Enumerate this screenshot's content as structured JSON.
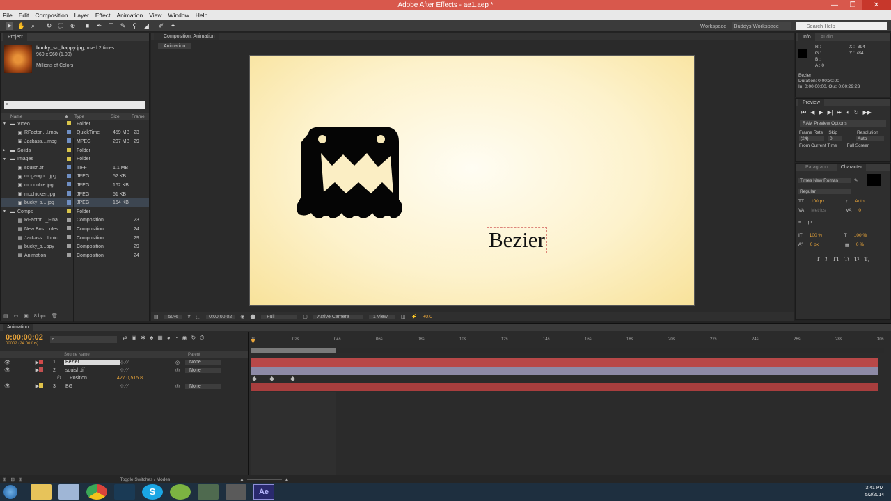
{
  "window": {
    "title": "Adobe After Effects - ae1.aep *"
  },
  "menu": [
    "File",
    "Edit",
    "Composition",
    "Layer",
    "Effect",
    "Animation",
    "View",
    "Window",
    "Help"
  ],
  "toolbar": {
    "workspace_label": "Workspace:",
    "workspace_value": "Buddys Workspace",
    "search_placeholder": "Search Help"
  },
  "project": {
    "tab": "Project",
    "selected_name": "bucky_so_happy.jpg",
    "used": ", used 2 times",
    "dims": "960 x 960 (1.00)",
    "colors": "Millions of Colors",
    "headers": {
      "name": "Name",
      "type": "Type",
      "size": "Size",
      "frame": "Frame"
    },
    "rows": [
      {
        "indent": 0,
        "twisty": "▼",
        "icon": "folder",
        "name": "Video",
        "color": "#d8c44a",
        "type": "Folder",
        "size": "",
        "frame": ""
      },
      {
        "indent": 1,
        "twisty": "",
        "icon": "file",
        "name": "RFactor....l.mov",
        "color": "#6f8fc4",
        "type": "QuickTime",
        "size": "459 MB",
        "frame": "23"
      },
      {
        "indent": 1,
        "twisty": "",
        "icon": "file",
        "name": "Jackass....mpg",
        "color": "#6f8fc4",
        "type": "MPEG",
        "size": "207 MB",
        "frame": "29"
      },
      {
        "indent": 0,
        "twisty": "▶",
        "icon": "folder",
        "name": "Solids",
        "color": "#d8c44a",
        "type": "Folder",
        "size": "",
        "frame": ""
      },
      {
        "indent": 0,
        "twisty": "▼",
        "icon": "folder",
        "name": "Images",
        "color": "#d8c44a",
        "type": "Folder",
        "size": "",
        "frame": ""
      },
      {
        "indent": 1,
        "twisty": "",
        "icon": "image",
        "name": "squish.tif",
        "color": "#6f8fc4",
        "type": "TIFF",
        "size": "1.1 MB",
        "frame": ""
      },
      {
        "indent": 1,
        "twisty": "",
        "icon": "image",
        "name": "mcgangb....jpg",
        "color": "#6f8fc4",
        "type": "JPEG",
        "size": "52 KB",
        "frame": ""
      },
      {
        "indent": 1,
        "twisty": "",
        "icon": "image",
        "name": "mcdouble.jpg",
        "color": "#6f8fc4",
        "type": "JPEG",
        "size": "162 KB",
        "frame": ""
      },
      {
        "indent": 1,
        "twisty": "",
        "icon": "image",
        "name": "mcchicken.jpg",
        "color": "#6f8fc4",
        "type": "JPEG",
        "size": "51 KB",
        "frame": ""
      },
      {
        "indent": 1,
        "twisty": "",
        "icon": "image",
        "name": "bucky_s....jpg",
        "color": "#6f8fc4",
        "type": "JPEG",
        "size": "164 KB",
        "frame": "",
        "selected": true
      },
      {
        "indent": 0,
        "twisty": "▼",
        "icon": "folder",
        "name": "Comps",
        "color": "#d8c44a",
        "type": "Folder",
        "size": "",
        "frame": ""
      },
      {
        "indent": 1,
        "twisty": "",
        "icon": "comp",
        "name": "RFactor..._Final",
        "color": "#a0a0a0",
        "type": "Composition",
        "size": "",
        "frame": "23"
      },
      {
        "indent": 1,
        "twisty": "",
        "icon": "comp",
        "name": "New Bos....ules",
        "color": "#a0a0a0",
        "type": "Composition",
        "size": "",
        "frame": "24"
      },
      {
        "indent": 1,
        "twisty": "",
        "icon": "comp",
        "name": "Jackass....lonic",
        "color": "#a0a0a0",
        "type": "Composition",
        "size": "",
        "frame": "29"
      },
      {
        "indent": 1,
        "twisty": "",
        "icon": "comp",
        "name": "bucky_s...ppy",
        "color": "#a0a0a0",
        "type": "Composition",
        "size": "",
        "frame": "29"
      },
      {
        "indent": 1,
        "twisty": "",
        "icon": "comp",
        "name": "Animation",
        "color": "#a0a0a0",
        "type": "Composition",
        "size": "",
        "frame": "24"
      }
    ],
    "bpc": "8 bpc"
  },
  "composition": {
    "tab": "Composition: Animation",
    "subtab": "Animation",
    "text_layer": "Bezier",
    "bg_color": "#f9e9b0",
    "footer": {
      "zoom": "50%",
      "timecode": "0:00:00:02",
      "resolution": "Full",
      "camera": "Active Camera",
      "view": "1 View",
      "exposure": "+0.0"
    }
  },
  "info": {
    "tab": "Info",
    "tab2": "Audio",
    "r": "R :",
    "g": "G :",
    "b": "B :",
    "a": "A : 0",
    "x": "X : -394",
    "y": "Y : 784",
    "layer": "Bezier",
    "duration": "Duration: 0:00:30:00",
    "inout": "In: 0:00:00:00, Out: 0:00:29:23"
  },
  "preview": {
    "tab": "Preview",
    "options": "RAM Preview Options",
    "frame_rate_label": "Frame Rate",
    "skip_label": "Skip",
    "resolution_label": "Resolution",
    "frame_rate": "(24)",
    "skip": "0",
    "resolution": "Auto",
    "from_current": "From Current Time",
    "full_screen": "Full Screen"
  },
  "character": {
    "tab_paragraph": "Paragraph",
    "tab_character": "Character",
    "font": "Times New Roman",
    "style": "Regular",
    "size": "100 px",
    "leading": "Auto",
    "kerning": "Metrics",
    "tracking": "0",
    "stroke_unit": "px",
    "vscale": "100 %",
    "hscale": "100 %",
    "baseline": "0 px",
    "tsume": "0 %"
  },
  "timeline": {
    "tab": "Animation",
    "timecode": "0:00:00:02",
    "fps": "00002 (24.00 fps)",
    "col_source": "Source Name",
    "col_parent": "Parent",
    "ruler": [
      "0s",
      "02s",
      "04s",
      "06s",
      "08s",
      "10s",
      "12s",
      "14s",
      "16s",
      "18s",
      "20s",
      "22s",
      "24s",
      "26s",
      "28s",
      "30s"
    ],
    "layers": [
      {
        "num": "1",
        "name": "Bezier",
        "color": "#d24a4a",
        "parent": "None",
        "bar_color": "#b84848"
      },
      {
        "num": "2",
        "name": "squish.tif",
        "color": "#c25050",
        "parent": "None",
        "bar_color": "#8d8aa6"
      },
      {
        "num": "",
        "name": "Position",
        "value": "427.0,515.8",
        "parent": "",
        "bar_color": ""
      },
      {
        "num": "3",
        "name": "BG",
        "color": "#e0c24a",
        "parent": "None",
        "bar_color": "#a83e3e"
      }
    ],
    "toggle_label": "Toggle Switches / Modes"
  },
  "taskbar": {
    "time": "3:41 PM",
    "date": "5/2/2014"
  }
}
